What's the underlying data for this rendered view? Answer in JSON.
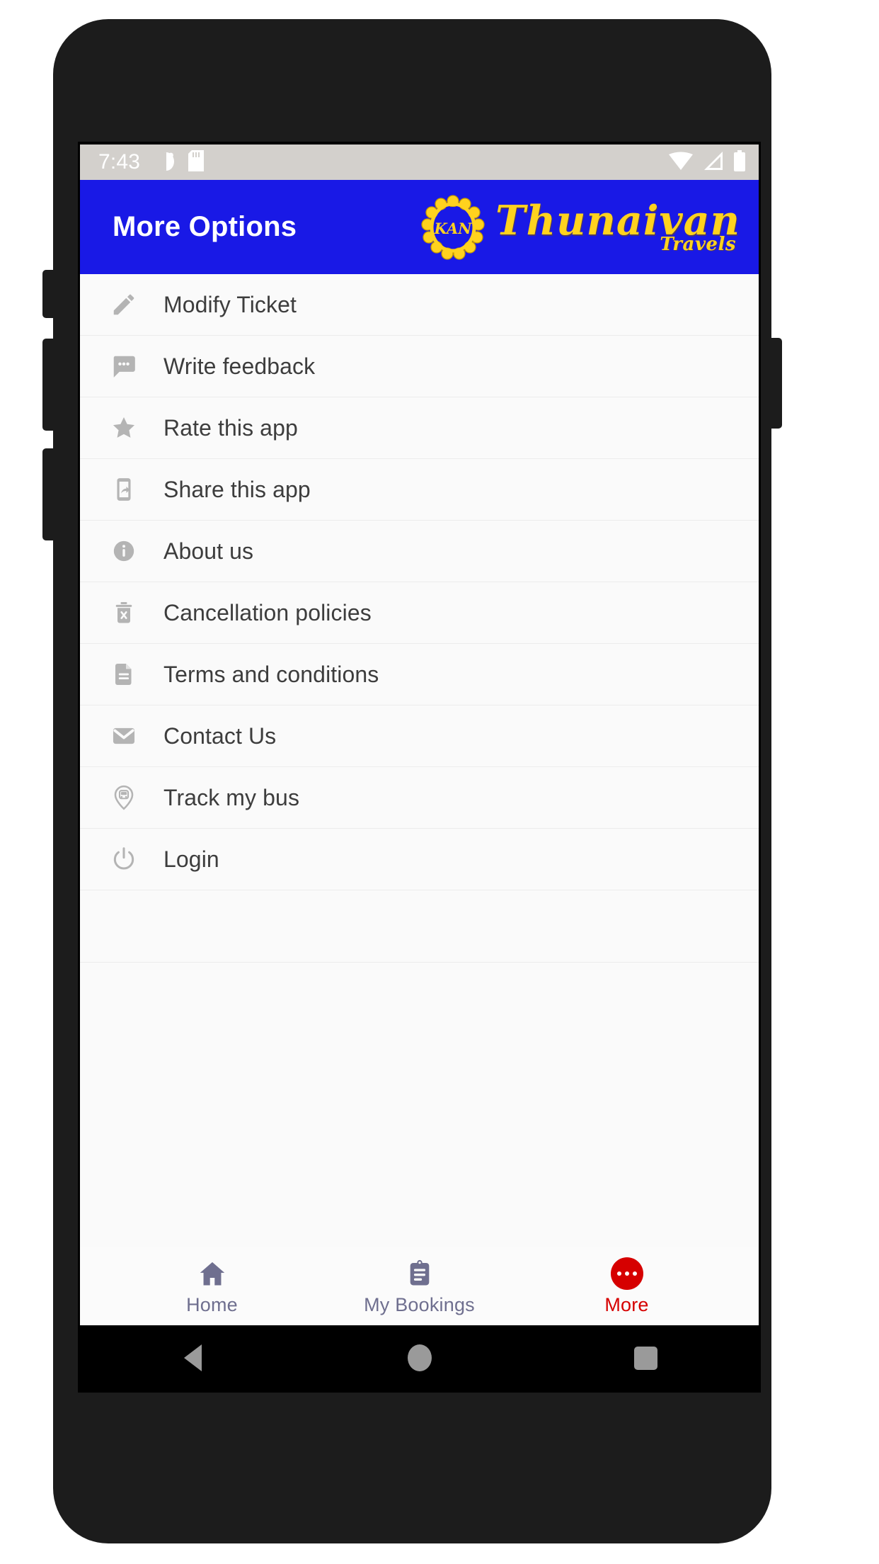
{
  "status_bar": {
    "time": "7:43",
    "left_icons": [
      "alarm-moon-icon",
      "sd-card-icon"
    ],
    "right_icons": [
      "wifi-icon",
      "cellular-signal-icon",
      "battery-icon"
    ]
  },
  "app_bar": {
    "title": "More Options",
    "background_color": "#1919E6",
    "title_color": "#FFFFFF",
    "brand": {
      "emblem_text": "KAN",
      "name": "Thunaivan",
      "sub": "Travels",
      "color": "#FFD21E"
    }
  },
  "menu": {
    "items": [
      {
        "label": "Modify Ticket",
        "icon": "pencil-icon"
      },
      {
        "label": "Write feedback",
        "icon": "chat-bubble-icon"
      },
      {
        "label": "Rate this app",
        "icon": "star-icon"
      },
      {
        "label": "Share this app",
        "icon": "share-phone-icon"
      },
      {
        "label": "About us",
        "icon": "info-circle-icon"
      },
      {
        "label": "Cancellation policies",
        "icon": "trash-x-icon"
      },
      {
        "label": "Terms and conditions",
        "icon": "document-icon"
      },
      {
        "label": "Contact Us",
        "icon": "envelope-icon"
      },
      {
        "label": "Track my bus",
        "icon": "map-pin-bus-icon"
      },
      {
        "label": "Login",
        "icon": "power-icon"
      }
    ]
  },
  "tab_bar": {
    "inactive_color": "#6F6F8F",
    "active_color": "#D60000",
    "tabs": [
      {
        "label": "Home",
        "icon": "home-icon",
        "active": false
      },
      {
        "label": "My Bookings",
        "icon": "clipboard-icon",
        "active": false
      },
      {
        "label": "More",
        "icon": "more-dots-icon",
        "active": true
      }
    ]
  },
  "system_nav": {
    "back": "back-triangle-icon",
    "home": "home-circle-icon",
    "recents": "recents-square-icon"
  }
}
